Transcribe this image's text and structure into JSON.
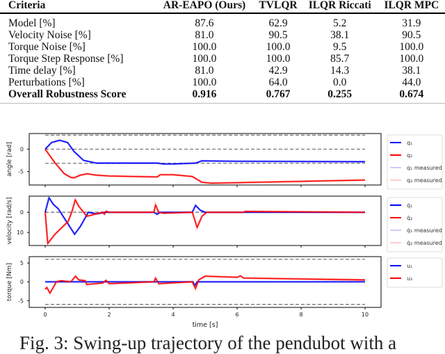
{
  "table": {
    "headers": [
      "Criteria",
      "AR-EAPO (Ours)",
      "TVLQR",
      "ILQR Riccati",
      "ILQR MPC"
    ],
    "rows": [
      [
        "Model [%]",
        "87.6",
        "62.9",
        "5.2",
        "31.9"
      ],
      [
        "Velocity Noise [%]",
        "81.0",
        "90.5",
        "38.1",
        "90.5"
      ],
      [
        "Torque Noise [%]",
        "100.0",
        "100.0",
        "9.5",
        "100.0"
      ],
      [
        "Torque Step Response [%]",
        "100.0",
        "100.0",
        "85.7",
        "100.0"
      ],
      [
        "Time delay [%]",
        "81.0",
        "42.9",
        "14.3",
        "38.1"
      ],
      [
        "Perturbations [%]",
        "100.0",
        "64.0",
        "0.0",
        "44.0"
      ],
      [
        "Overall Robustness Score",
        "0.916",
        "0.767",
        "0.255",
        "0.674"
      ]
    ]
  },
  "chart_data": [
    {
      "type": "line",
      "ylabel": "angle [rad]",
      "xlim": [
        -0.5,
        10.5
      ],
      "ylim": [
        -8,
        3.5
      ],
      "yticks": [
        0,
        -5
      ],
      "ytick_labels": [
        "0",
        "-5"
      ],
      "xticks": [
        0,
        2,
        4,
        6,
        8,
        10
      ],
      "hlines": [
        3.14,
        0,
        -3.14
      ],
      "series": [
        {
          "name": "q₁",
          "color": "#0000ff",
          "x": [
            0,
            0.2,
            0.45,
            0.7,
            0.9,
            1.2,
            1.6,
            3.5,
            3.7,
            4.0,
            4.7,
            4.9,
            6,
            10
          ],
          "y": [
            0,
            1.5,
            2,
            1.5,
            -0.5,
            -2.5,
            -3.1,
            -3.1,
            -3.3,
            -3.3,
            -3.1,
            -2.6,
            -2.7,
            -2.8
          ]
        },
        {
          "name": "q₂",
          "color": "#ff0000",
          "x": [
            0,
            0.3,
            0.6,
            0.8,
            0.9,
            1.1,
            1.3,
            1.6,
            2,
            3.5,
            3.6,
            4,
            4.6,
            4.9,
            5.2,
            10
          ],
          "y": [
            0,
            -3,
            -5.5,
            -6.3,
            -6.4,
            -5.8,
            -5.5,
            -5.8,
            -6,
            -6.2,
            -5.7,
            -5.7,
            -6.1,
            -7.4,
            -7.6,
            -6.9
          ]
        },
        {
          "name": "q₁ measured",
          "color": "#9999ff"
        },
        {
          "name": "q₂ measured",
          "color": "#ff9999"
        }
      ]
    },
    {
      "type": "line",
      "ylabel": "velocity [rad/s]",
      "xlim": [
        -0.5,
        10.5
      ],
      "ylim": [
        -16.5,
        8
      ],
      "yticks": [
        0,
        -10
      ],
      "ytick_labels": [
        "0",
        "10"
      ],
      "xticks": [
        0,
        2,
        4,
        6,
        8,
        10
      ],
      "hlines": [
        0
      ],
      "series": [
        {
          "name": "q̇₁",
          "color": "#0000ff",
          "x": [
            0,
            0.12,
            0.25,
            0.41,
            0.6,
            0.92,
            1.1,
            1.35,
            1.6,
            1.9,
            3.4,
            3.5,
            3.6,
            4.6,
            4.7,
            4.85,
            5.0,
            10
          ],
          "y": [
            0,
            7.2,
            4,
            1.7,
            -3,
            -10.9,
            -7,
            0,
            -0.8,
            0,
            0,
            -1,
            0,
            0,
            3.4,
            1,
            0,
            0
          ]
        },
        {
          "name": "q̇₂",
          "color": "#ff0000",
          "x": [
            0,
            0.08,
            0.3,
            0.72,
            0.85,
            0.94,
            1.05,
            1.2,
            1.3,
            1.8,
            1.85,
            1.9,
            2.0,
            3.4,
            3.45,
            3.55,
            3.7,
            4.6,
            4.75,
            4.9,
            5.05,
            6.2,
            6.25,
            10
          ],
          "y": [
            0,
            -15.5,
            -11,
            -4.5,
            1,
            6.2,
            3,
            0,
            -2,
            0,
            -1,
            0.5,
            0,
            0,
            3.7,
            0,
            -0.5,
            0,
            -7.6,
            -2,
            0,
            0,
            0.4,
            0
          ]
        },
        {
          "name": "q̇₁ measured",
          "color": "#9999ff"
        },
        {
          "name": "q̇₂ measured",
          "color": "#ff9999"
        }
      ]
    },
    {
      "type": "line",
      "ylabel": "torque [Nm]",
      "xlabel": "time [s]",
      "xlim": [
        -0.5,
        10.5
      ],
      "ylim": [
        -6.8,
        6.7
      ],
      "yticks": [
        5,
        0,
        -5
      ],
      "ytick_labels": [
        "5",
        "0",
        "-5"
      ],
      "xticks": [
        0,
        2,
        4,
        6,
        8,
        10
      ],
      "xtick_labels": [
        "0",
        "2",
        "4",
        "6",
        "8",
        "10"
      ],
      "hlines": [
        6,
        -6
      ],
      "series": [
        {
          "name": "u₁",
          "color": "#0000ff",
          "x": [
            0,
            4.62,
            4.68,
            4.75,
            10
          ],
          "y": [
            0,
            0,
            -1,
            0,
            0
          ]
        },
        {
          "name": "u₂",
          "color": "#ff0000",
          "x": [
            0,
            0.05,
            0.15,
            0.35,
            0.5,
            0.8,
            0.95,
            1.05,
            1.25,
            1.3,
            1.8,
            1.9,
            2.0,
            3.4,
            3.45,
            3.55,
            4.6,
            4.7,
            4.8,
            5.0,
            6.0,
            6.1,
            6.2,
            10
          ],
          "y": [
            -2,
            -1.5,
            -3,
            0,
            0.3,
            0,
            1.5,
            0.5,
            0.3,
            -0.7,
            -0.3,
            0.4,
            -0.5,
            0,
            1,
            -0.5,
            0,
            -1.8,
            0.5,
            1.5,
            1.2,
            1.6,
            1.0,
            0.5
          ]
        }
      ]
    }
  ],
  "caption": "Fig. 3: Swing-up trajectory of the pendubot with a"
}
